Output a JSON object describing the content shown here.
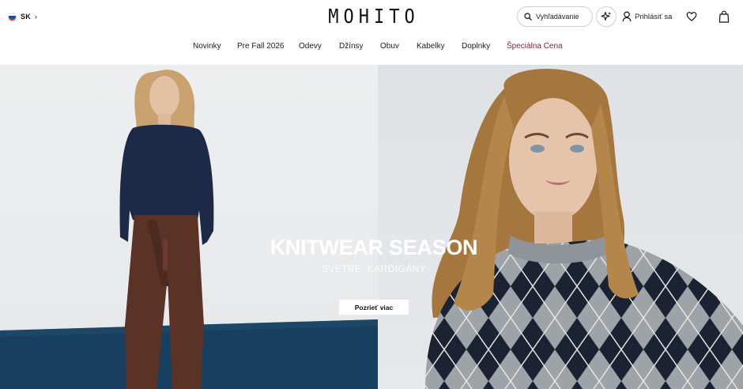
{
  "header": {
    "locale": {
      "code": "SK",
      "chevron": "›",
      "flag_colors": [
        "#ffffff",
        "#0b4ea2",
        "#ee1c25"
      ]
    },
    "logo": "MOHITO",
    "search": {
      "placeholder": "Vyhľadávanie",
      "icon": "search-icon"
    },
    "ai_button": {
      "icon": "sparkle-icon"
    },
    "login": {
      "label": "Prihlásiť sa",
      "icon": "user-icon"
    },
    "wishlist": {
      "icon": "heart-icon"
    },
    "cart": {
      "icon": "bag-icon"
    }
  },
  "nav": {
    "items": [
      "Novinky",
      "Pre Fall 2026",
      "Odevy",
      "Džínsy",
      "Obuv",
      "Kabelky",
      "Doplnky",
      "Špeciálna Cena"
    ],
    "special_color": "#6e2a3c"
  },
  "hero": {
    "title": "KNITWEAR SEASON",
    "subtitle": "SVETRE, KARDIGÁNY",
    "cta": "Pozrieť viac"
  }
}
